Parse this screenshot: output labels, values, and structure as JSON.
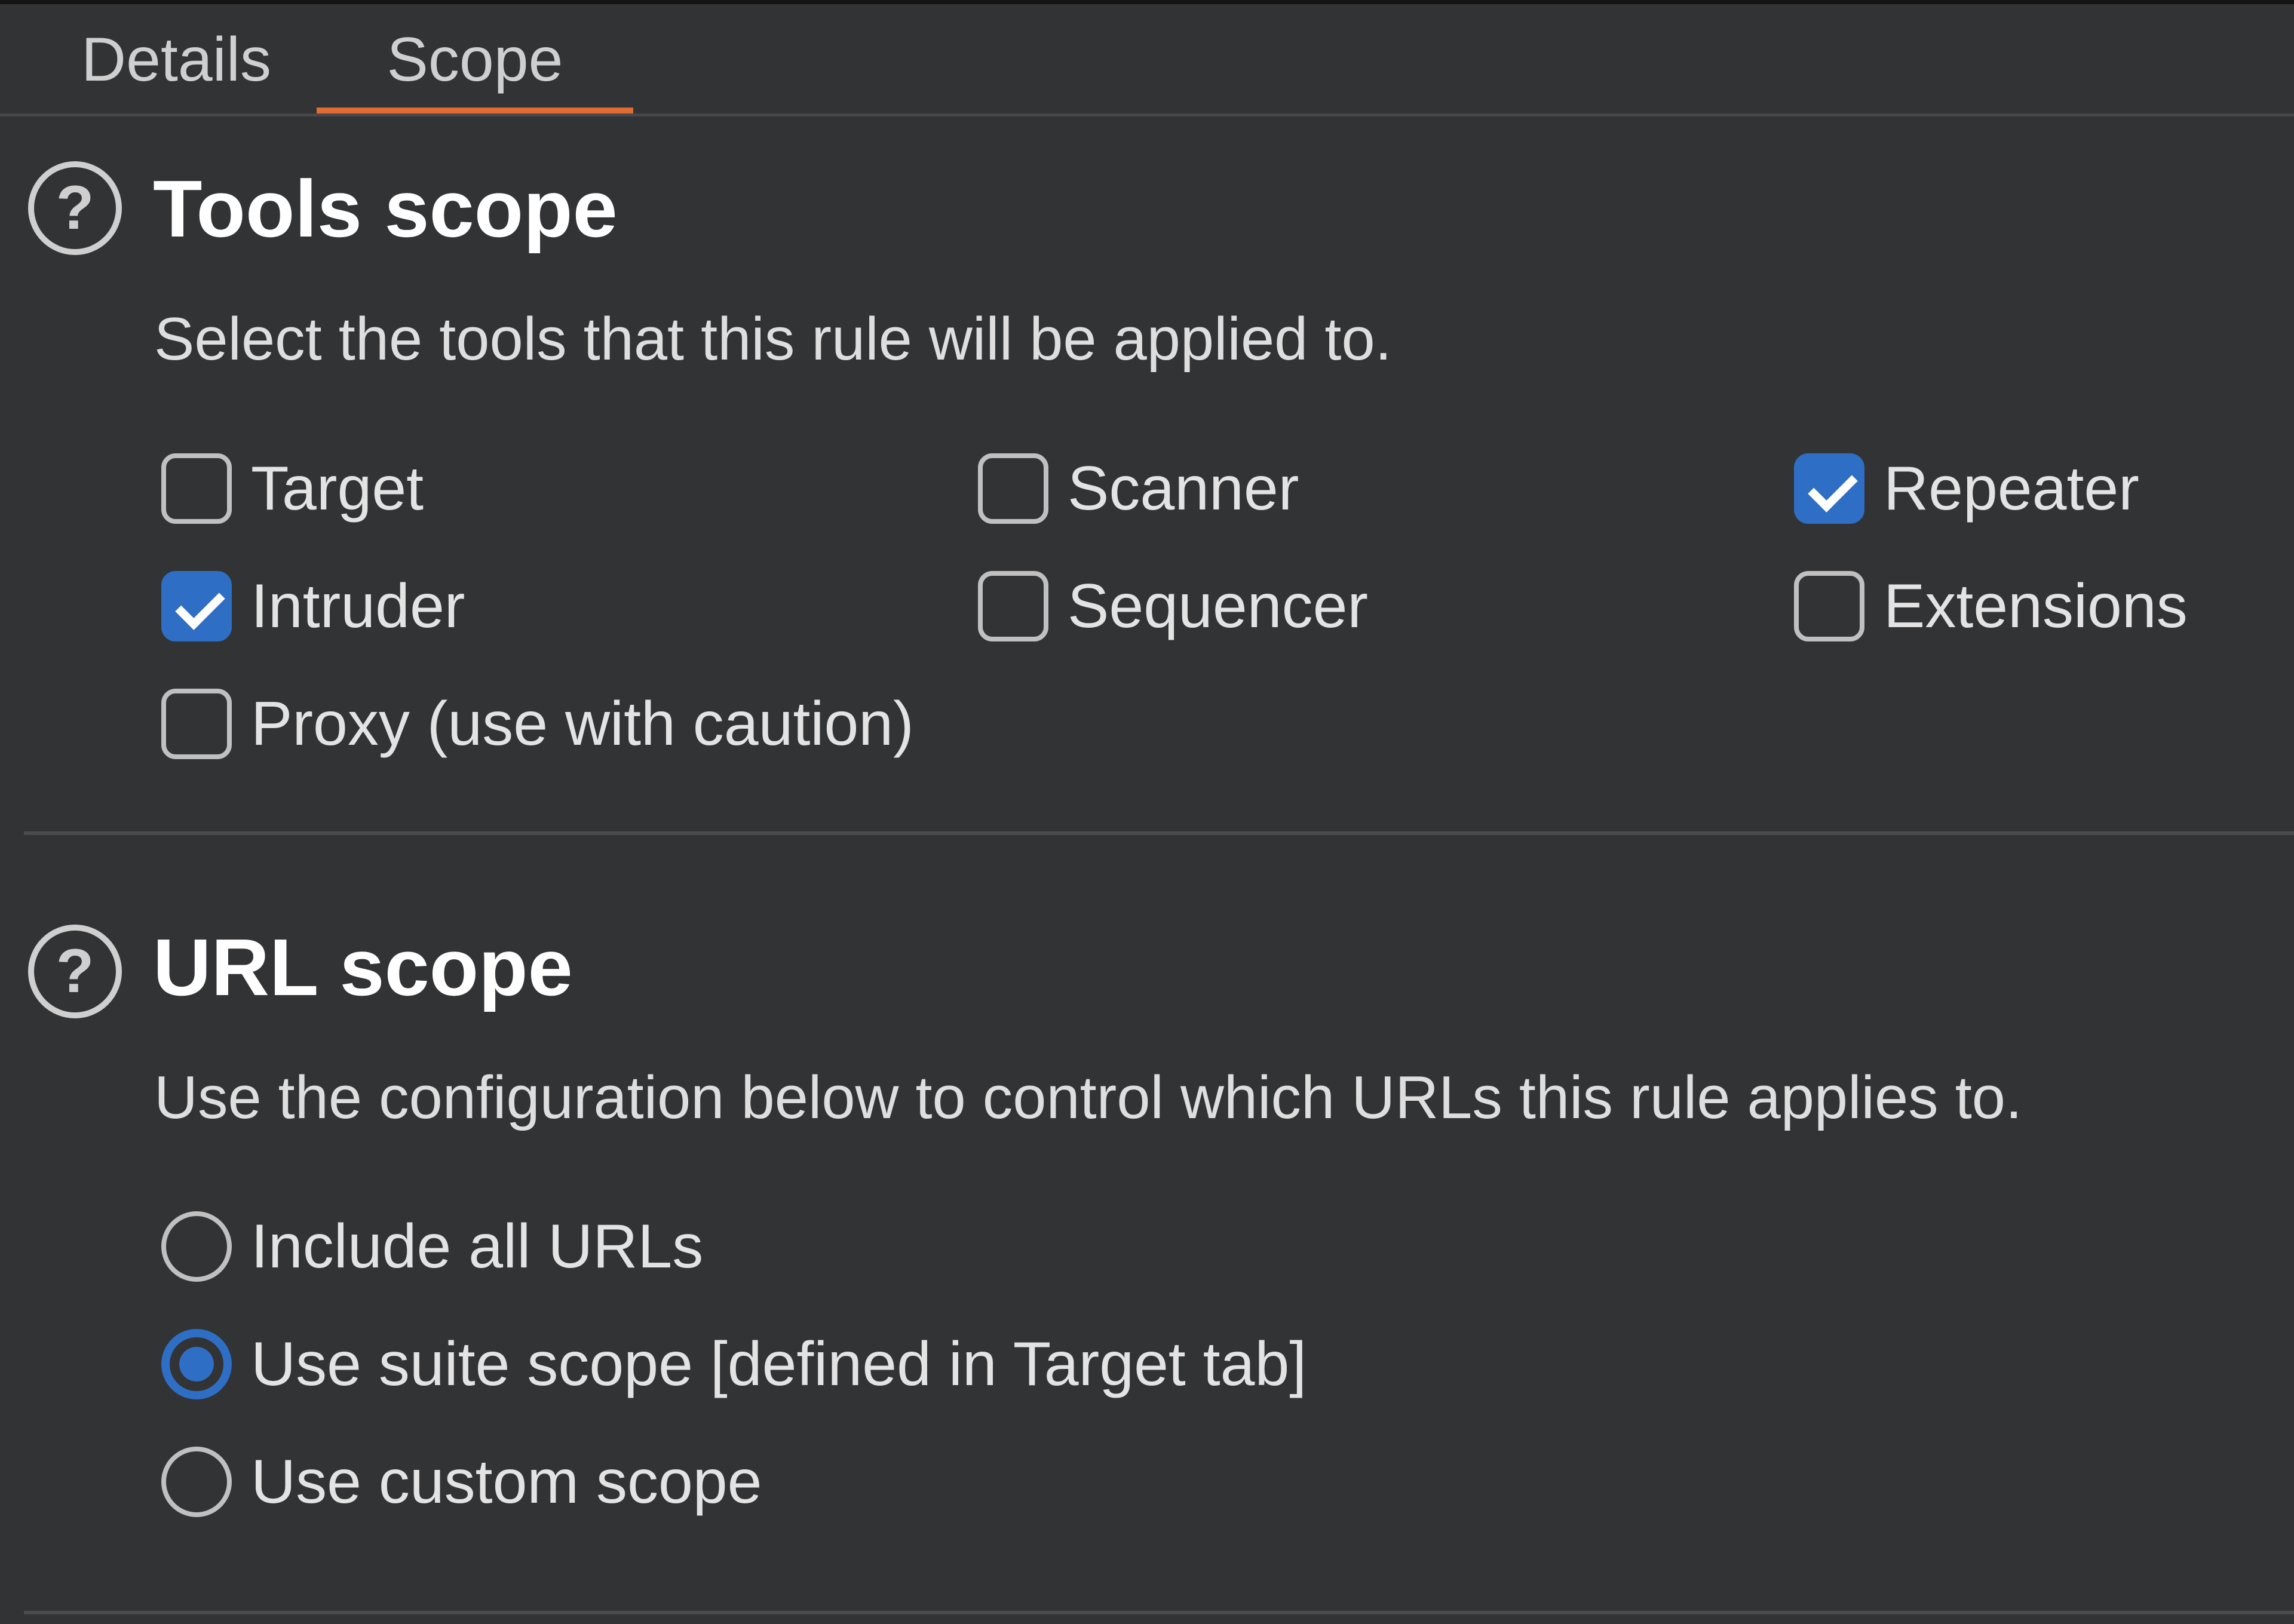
{
  "tabs": {
    "details": "Details",
    "scope": "Scope",
    "active": "Scope"
  },
  "colors": {
    "background": "#323335",
    "accent_tab": "#e06b34",
    "accent_control": "#2e6ec4"
  },
  "tools_scope": {
    "title": "Tools scope",
    "description": "Select the tools that this rule will be applied to.",
    "help_icon": "question-circle-icon",
    "options": [
      {
        "label": "Target",
        "checked": false
      },
      {
        "label": "Scanner",
        "checked": false
      },
      {
        "label": "Repeater",
        "checked": true
      },
      {
        "label": "Intruder",
        "checked": true
      },
      {
        "label": "Sequencer",
        "checked": false
      },
      {
        "label": "Extensions",
        "checked": false
      },
      {
        "label": "Proxy (use with caution)",
        "checked": false
      }
    ]
  },
  "url_scope": {
    "title": "URL scope",
    "description": "Use the configuration below to control which URLs this rule applies to.",
    "help_icon": "question-circle-icon",
    "options": [
      {
        "label": "Include all URLs",
        "selected": false
      },
      {
        "label": "Use suite scope [defined in Target tab]",
        "selected": true
      },
      {
        "label": "Use custom scope",
        "selected": false
      }
    ]
  }
}
